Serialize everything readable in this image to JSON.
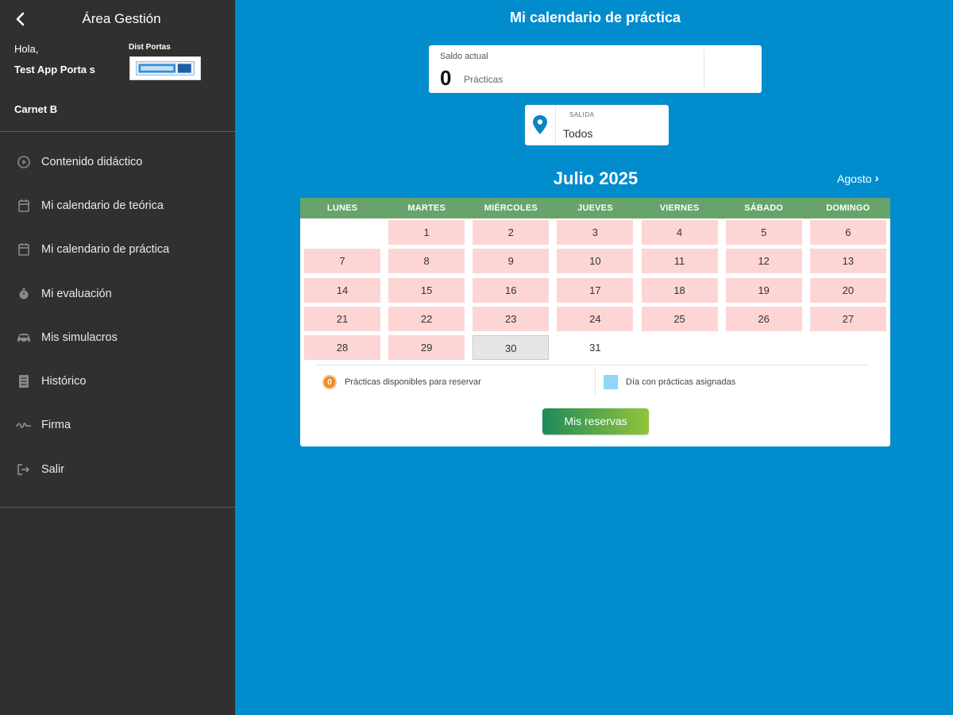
{
  "sidebar": {
    "title": "Área Gestión",
    "greeting": "Hola,",
    "user_name": "Test App Porta s",
    "license": "Carnet B",
    "school_name": "Dist Portas",
    "items": [
      {
        "label": "Contenido didáctico",
        "icon": "play-circle-icon"
      },
      {
        "label": "Mi calendario de teórica",
        "icon": "calendar-icon"
      },
      {
        "label": "Mi calendario de práctica",
        "icon": "calendar-icon"
      },
      {
        "label": "Mi evaluación",
        "icon": "stopwatch-icon"
      },
      {
        "label": "Mis simulacros",
        "icon": "car-icon"
      },
      {
        "label": "Histórico",
        "icon": "document-icon"
      },
      {
        "label": "Firma",
        "icon": "signature-icon"
      },
      {
        "label": "Salir",
        "icon": "logout-icon"
      }
    ]
  },
  "main": {
    "title": "Mi calendario de práctica",
    "saldo": {
      "label": "Saldo actual",
      "value": "0",
      "unit": "Prácticas"
    },
    "salida": {
      "label": "SALIDA",
      "value": "Todos"
    },
    "month": "Julio 2025",
    "next_month": "Agosto",
    "weekdays": [
      "LUNES",
      "MARTES",
      "MIÉRCOLES",
      "JUEVES",
      "VIERNES",
      "SÁBADO",
      "DOMINGO"
    ],
    "days": [
      {
        "d": "1",
        "s": "pink"
      },
      {
        "d": "2",
        "s": "pink"
      },
      {
        "d": "3",
        "s": "pink"
      },
      {
        "d": "4",
        "s": "pink"
      },
      {
        "d": "5",
        "s": "pink"
      },
      {
        "d": "6",
        "s": "pink"
      },
      {
        "d": "7",
        "s": "pink"
      },
      {
        "d": "8",
        "s": "pink"
      },
      {
        "d": "9",
        "s": "pink"
      },
      {
        "d": "10",
        "s": "pink"
      },
      {
        "d": "11",
        "s": "pink"
      },
      {
        "d": "12",
        "s": "pink"
      },
      {
        "d": "13",
        "s": "pink"
      },
      {
        "d": "14",
        "s": "pink"
      },
      {
        "d": "15",
        "s": "pink"
      },
      {
        "d": "16",
        "s": "pink"
      },
      {
        "d": "17",
        "s": "pink"
      },
      {
        "d": "18",
        "s": "pink"
      },
      {
        "d": "19",
        "s": "pink"
      },
      {
        "d": "20",
        "s": "pink"
      },
      {
        "d": "21",
        "s": "pink"
      },
      {
        "d": "22",
        "s": "pink"
      },
      {
        "d": "23",
        "s": "pink"
      },
      {
        "d": "24",
        "s": "pink"
      },
      {
        "d": "25",
        "s": "pink"
      },
      {
        "d": "26",
        "s": "pink"
      },
      {
        "d": "27",
        "s": "pink"
      },
      {
        "d": "28",
        "s": "pink"
      },
      {
        "d": "29",
        "s": "pink"
      },
      {
        "d": "30",
        "s": "grey"
      },
      {
        "d": "31",
        "s": "none"
      }
    ],
    "first_weekday_index": 1,
    "legend": {
      "available_badge": "0",
      "available_text": "Prácticas disponibles para reservar",
      "assigned_text": "Día con prácticas asignadas"
    },
    "reservas_button": "Mis reservas",
    "colors": {
      "background": "#008ccd",
      "sidebar": "#303031",
      "calendar_header": "#66a46b",
      "day_available": "#fdd5d5",
      "day_selected": "#e6e6e6",
      "badge": "#f08a24",
      "assigned_swatch": "#90d7f5"
    }
  }
}
